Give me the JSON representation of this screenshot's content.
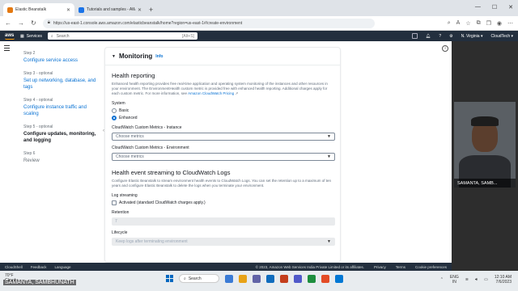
{
  "browser": {
    "tabs": [
      {
        "title": "Elastic Beanstalk",
        "active": true
      },
      {
        "title": "Tutorials and samples - AWS El",
        "active": false
      }
    ],
    "url": "https://us-east-1.console.aws.amazon.com/elasticbeanstalk/home?region=us-east-1#/create-environment"
  },
  "aws_nav": {
    "logo": "aws",
    "services": "Services",
    "search_placeholder": "Search",
    "search_shortcut": "[Alt+S]",
    "region": "N. Virginia ▾",
    "account": "CloudTech ▾"
  },
  "steps": [
    {
      "label": "Step 2",
      "name": "Configure service access",
      "state": "link"
    },
    {
      "label": "Step 3 - optional",
      "name": "Set up networking, database, and tags",
      "state": "link"
    },
    {
      "label": "Step 4 - optional",
      "name": "Configure instance traffic and scaling",
      "state": "link"
    },
    {
      "label": "Step 5 - optional",
      "name": "Configure updates, monitoring, and logging",
      "state": "current"
    },
    {
      "label": "Step 6",
      "name": "Review",
      "state": "plain"
    }
  ],
  "panel": {
    "title": "Monitoring",
    "info": "Info",
    "health": {
      "heading": "Health reporting",
      "description": "Enhanced health reporting provides free real-time application and operating system monitoring of the instances and other resources in your environment. The EnvironmentHealth custom metric is provided free with enhanced health reporting. Additional charges apply for each custom metric. For more information, see",
      "link": "Amazon CloudWatch Pricing",
      "system_label": "System",
      "options": [
        "Basic",
        "Enhanced"
      ],
      "selected": "Enhanced",
      "instance_label": "CloudWatch Custom Metrics - Instance",
      "instance_placeholder": "Choose metrics",
      "env_label": "CloudWatch Custom Metrics - Environment",
      "env_placeholder": "Choose metrics"
    },
    "streaming": {
      "heading": "Health event streaming to CloudWatch Logs",
      "description": "Configure Elastic Beanstalk to stream environment health events to CloudWatch Logs. You can set the retention up to a maximum of ten years and configure Elastic Beanstalk to delete the logs when you terminate your environment.",
      "log_label": "Log streaming",
      "checkbox_label": "Activated (standard CloudWatch charges apply.)",
      "retention_label": "Retention",
      "retention_value": "7",
      "lifecycle_label": "Lifecycle",
      "lifecycle_value": "Keep logs after terminating environment"
    }
  },
  "footer": {
    "cloudshell": "CloudShell",
    "feedback": "Feedback",
    "language": "Language",
    "copyright": "© 2023, Amazon Web Services India Private Limited or its affiliates.",
    "privacy": "Privacy",
    "terms": "Terms",
    "cookies": "Cookie preferences"
  },
  "webcam": {
    "name": "SAMANTA, SAMB..."
  },
  "speaker_name": "SAMANTA, SAMBHUNATH",
  "taskbar": {
    "temp": "70°F",
    "weather": "Cloudy",
    "search": "Search",
    "lang": "ENG",
    "lang2": "IN",
    "time": "12:10 AM",
    "date": "7/6/2023",
    "icon_colors": [
      "#3a7bd5",
      "#e8a317",
      "#6264a7",
      "#0f6cbd",
      "#c43e1c",
      "#5059c9",
      "#1e8e3e",
      "#e34c26",
      "#0078d4"
    ]
  }
}
